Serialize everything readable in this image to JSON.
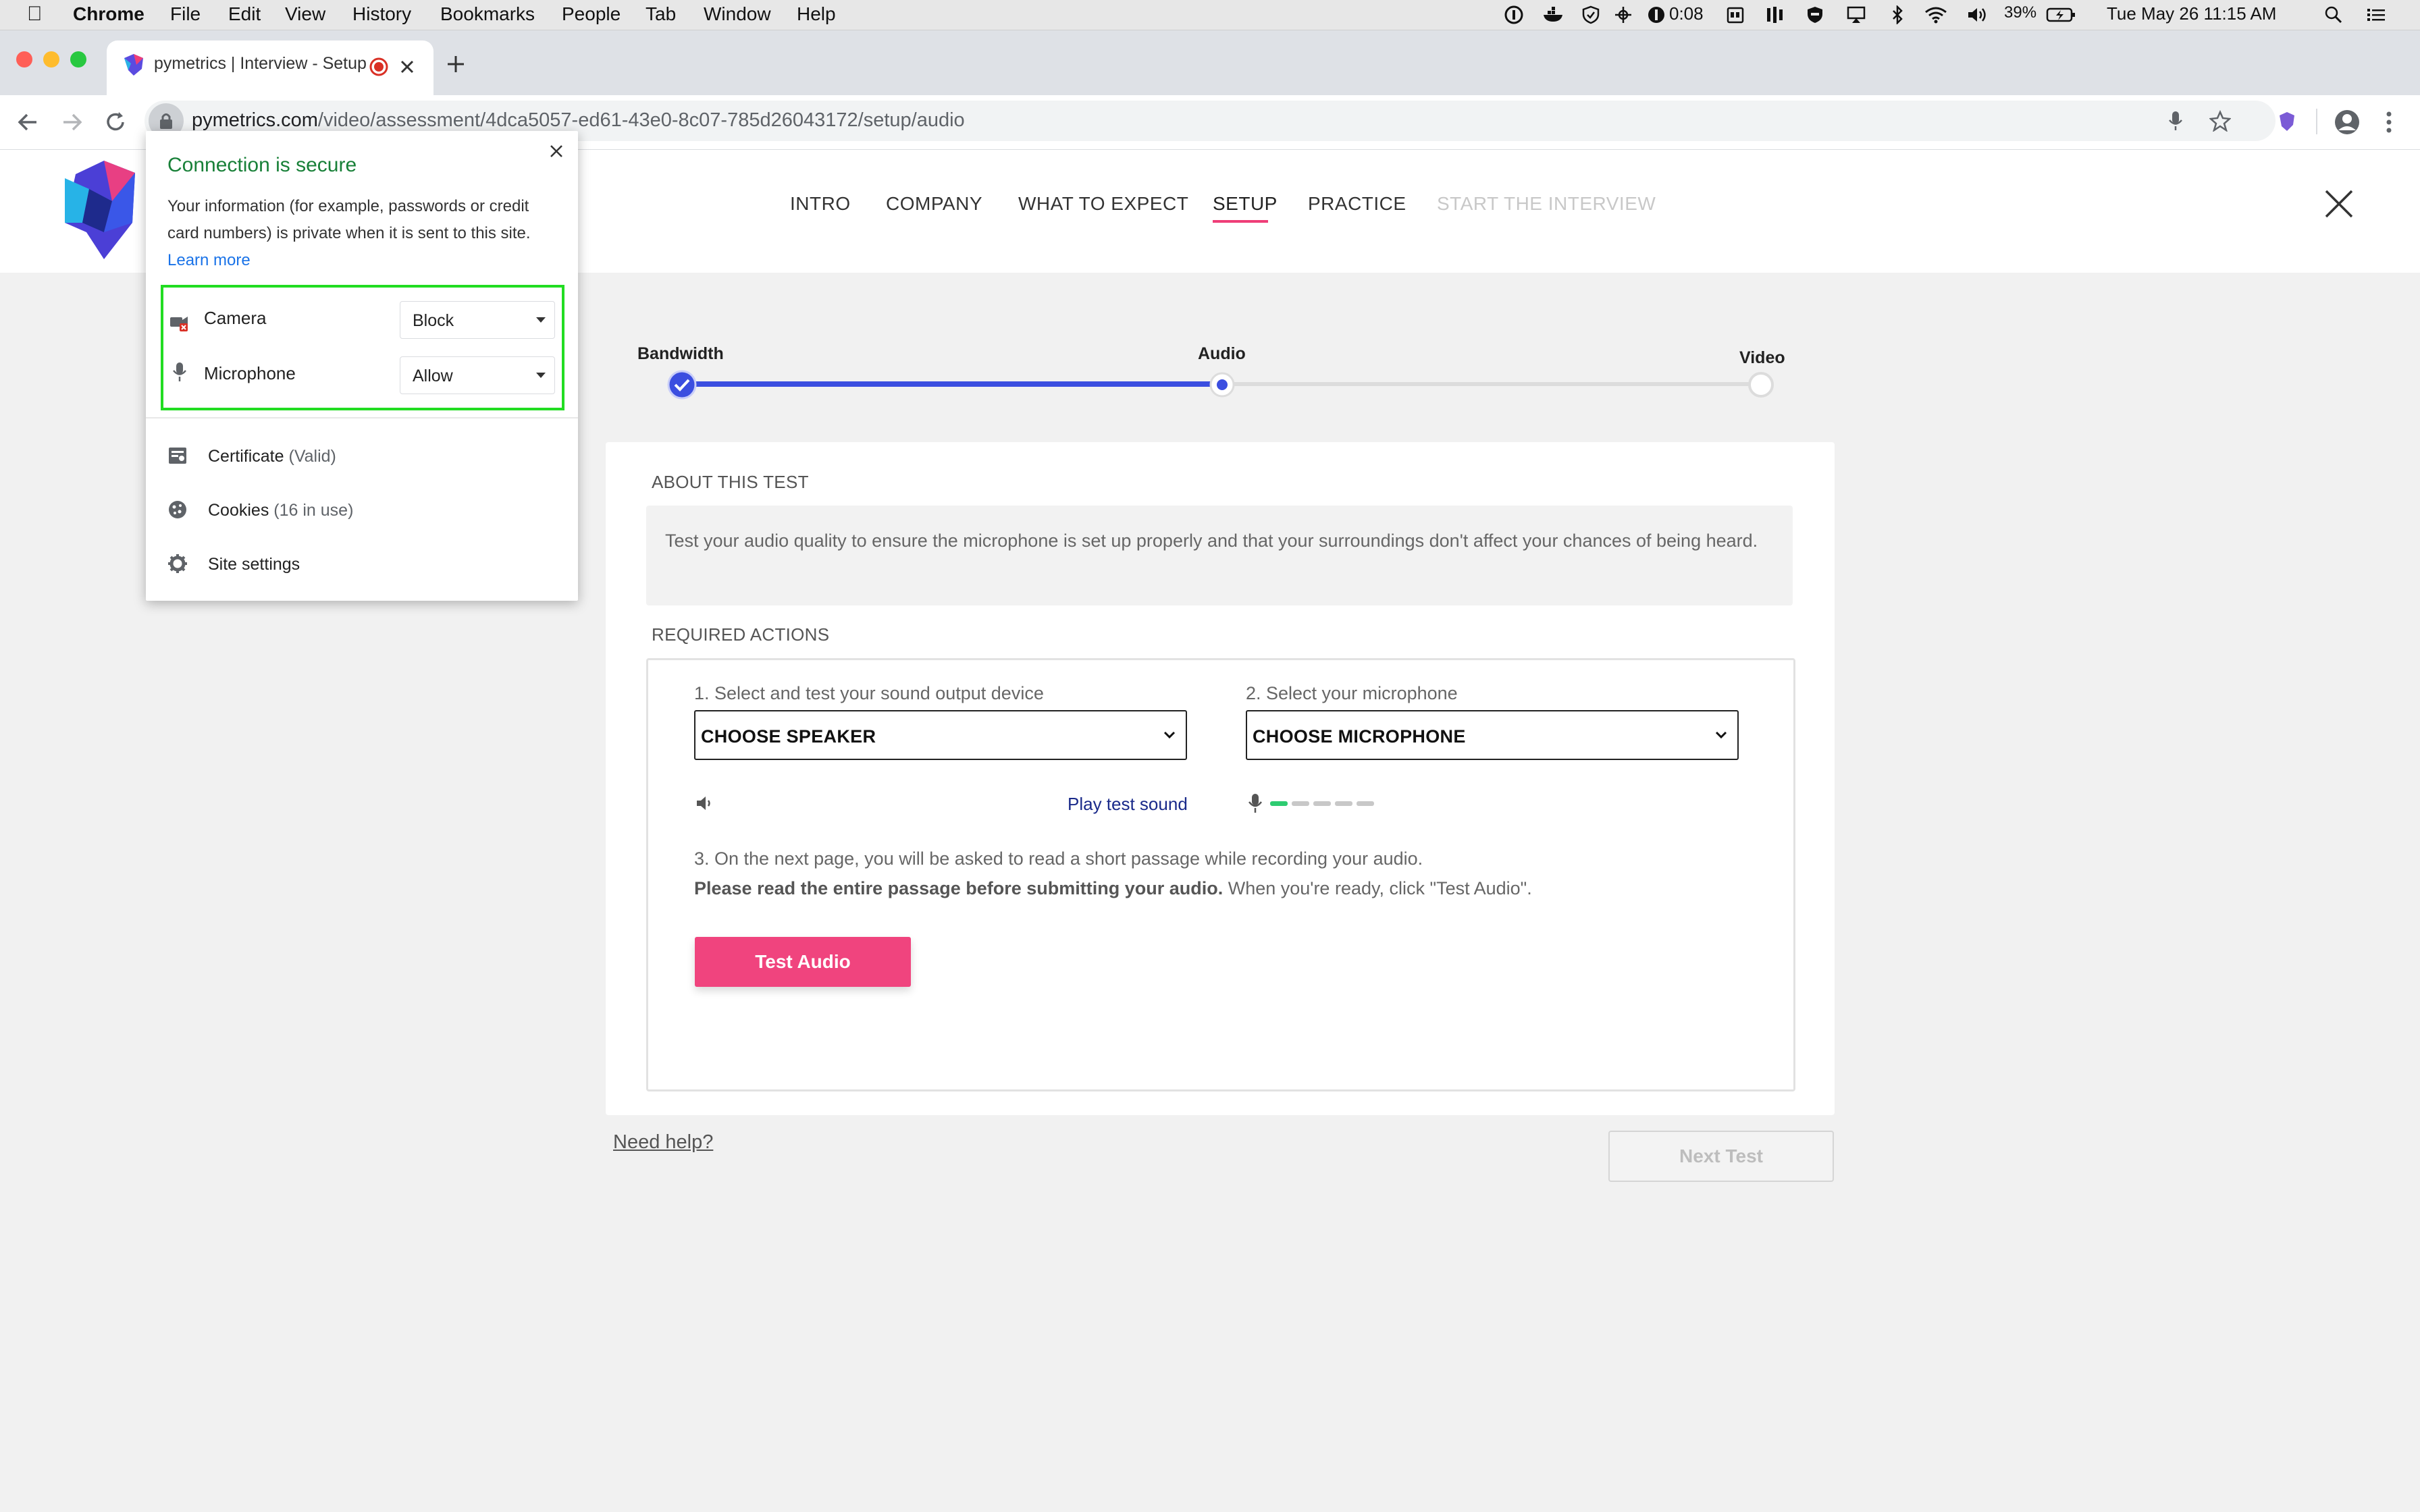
{
  "menubar": {
    "app_name": "Chrome",
    "menus": [
      "File",
      "Edit",
      "View",
      "History",
      "Bookmarks",
      "People",
      "Tab",
      "Window",
      "Help"
    ],
    "timer": "0:08",
    "battery": "39%",
    "datetime": "Tue May 26  11:15 AM"
  },
  "browser": {
    "tab_title": "pymetrics | Interview - Setup",
    "url_host": "pymetrics.com",
    "url_path": "/video/assessment/4dca5057-ed61-43e0-8c07-785d26043172/setup/audio"
  },
  "site_nav": {
    "items": [
      "INTRO",
      "COMPANY",
      "WHAT TO EXPECT",
      "SETUP",
      "PRACTICE",
      "START THE INTERVIEW"
    ],
    "active": "SETUP"
  },
  "stepper": {
    "steps": [
      "Bandwidth",
      "Audio",
      "Video"
    ],
    "current": "Audio"
  },
  "about": {
    "heading": "ABOUT THIS TEST",
    "text": "Test your audio quality to ensure the microphone is set up properly and that your surroundings don't affect your chances of being heard."
  },
  "actions": {
    "heading": "REQUIRED ACTIONS",
    "speaker_label": "1. Select and test your sound output device",
    "speaker_value": "CHOOSE SPEAKER",
    "mic_label": "2. Select your microphone",
    "mic_value": "CHOOSE MICROPHONE",
    "play_test_sound": "Play test sound",
    "mic_level": 0.2,
    "step3_text": "3. On the next page, you will be asked to read a short passage while recording your audio.",
    "step3_bold": "Please read the entire passage before submitting your audio.",
    "step3_tail": " When you're ready, click \"Test Audio\".",
    "test_audio_button": "Test Audio"
  },
  "footer": {
    "need_help": "Need help?",
    "next_test": "Next Test"
  },
  "popup": {
    "title": "Connection is secure",
    "description": "Your information (for example, passwords or credit card numbers) is private when it is sent to this site.",
    "learn_more": "Learn more",
    "camera_label": "Camera",
    "camera_value": "Block",
    "microphone_label": "Microphone",
    "microphone_value": "Allow",
    "certificate_label": "Certificate",
    "certificate_status": "(Valid)",
    "cookies_label": "Cookies",
    "cookies_status": "(16 in use)",
    "site_settings_label": "Site settings"
  },
  "colors": {
    "accent_pink": "#f0447e",
    "progress_blue": "#3b4ee0",
    "secure_green": "#188038",
    "highlight_green": "#22dd22"
  }
}
